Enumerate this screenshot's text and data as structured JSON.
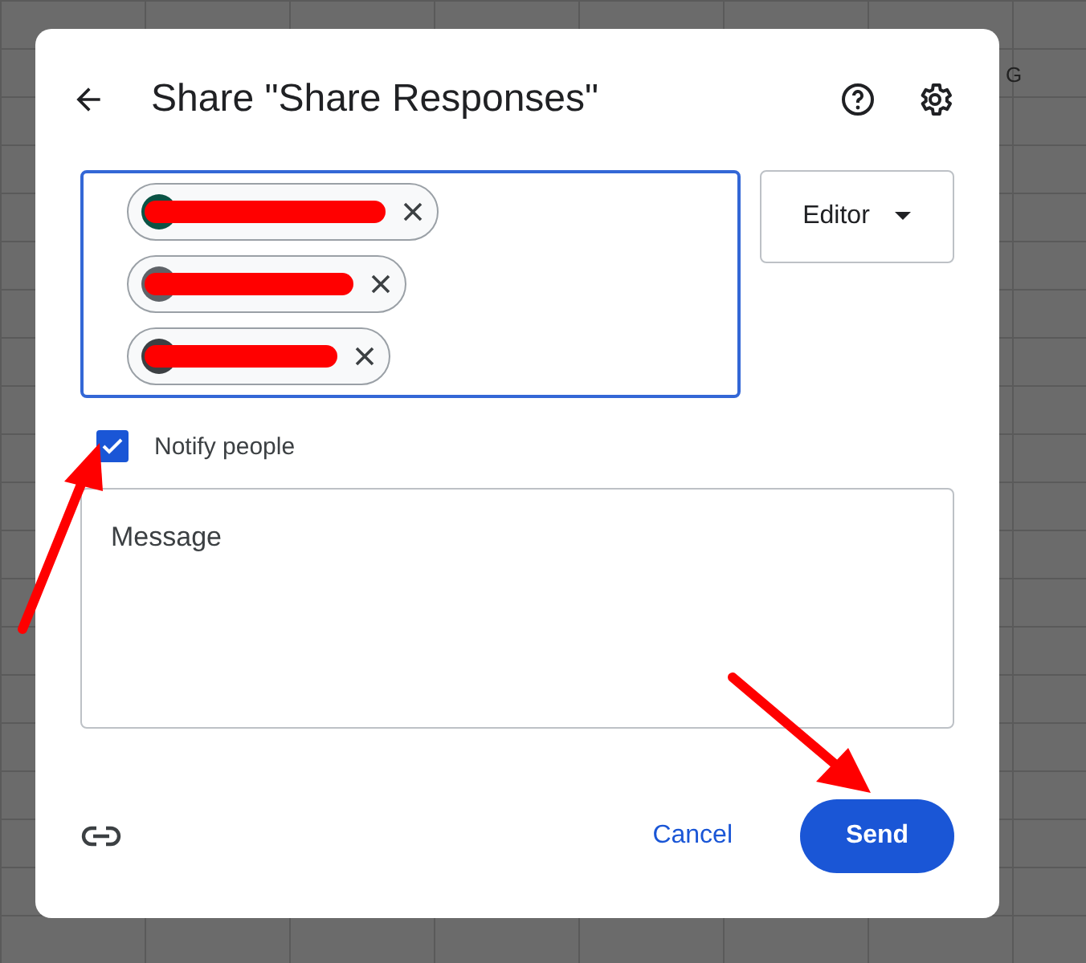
{
  "background_sheet": {
    "column_header": "G"
  },
  "dialog": {
    "title": "Share \"Share Responses\"",
    "recipients": [
      {
        "color": "#0b5345"
      },
      {
        "color": "#5f6368"
      },
      {
        "color": "#3c4043"
      }
    ],
    "role": {
      "label": "Editor"
    },
    "notify": {
      "label": "Notify people",
      "checked": true
    },
    "message": {
      "placeholder": "Message"
    },
    "buttons": {
      "cancel": "Cancel",
      "send": "Send"
    }
  }
}
